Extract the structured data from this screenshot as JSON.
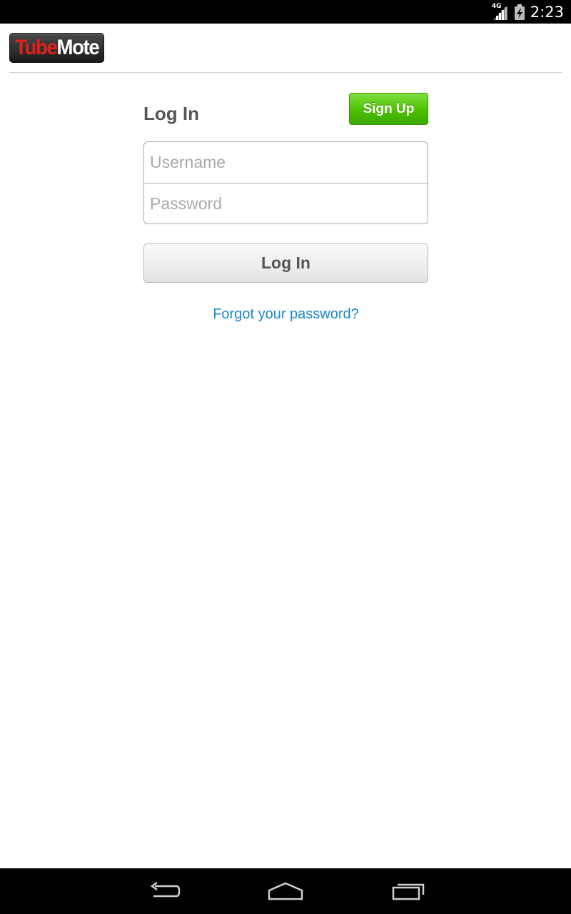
{
  "status_bar": {
    "network": "4G",
    "time": "2:23",
    "icons": [
      "signal-icon",
      "battery-charging-icon"
    ]
  },
  "app": {
    "logo_part1": "Tube",
    "logo_part2": "Mote",
    "brand_red": "#e0211b"
  },
  "login": {
    "title": "Log In",
    "signup_label": "Sign Up",
    "username_placeholder": "Username",
    "username_value": "",
    "password_placeholder": "Password",
    "password_value": "",
    "login_button_label": "Log In",
    "forgot_link": "Forgot your password?"
  },
  "nav_bar": {
    "icons": [
      "back-icon",
      "home-icon",
      "recent-apps-icon"
    ]
  },
  "colors": {
    "signup_green": "#4cc000",
    "link_blue": "#1b87c9"
  }
}
